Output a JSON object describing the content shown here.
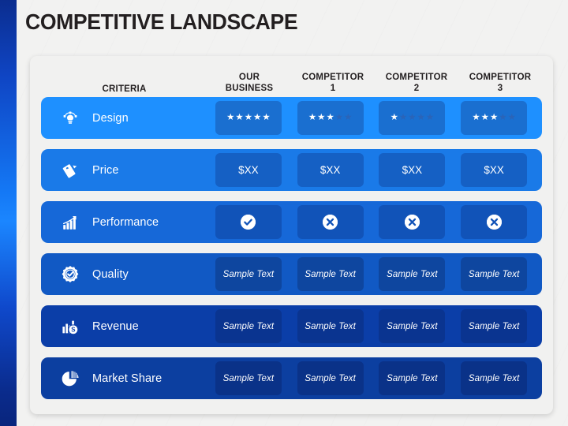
{
  "slide": {
    "title": "COMPETITIVE LANDSCAPE"
  },
  "table": {
    "headers": {
      "criteria": "CRITERIA",
      "columns": [
        "OUR\nBUSINESS",
        "COMPETITOR\n1",
        "COMPETITOR\n2",
        "COMPETITOR\n3"
      ]
    },
    "rows": [
      {
        "label": "Design",
        "icon": "pen-nib-icon",
        "type": "rating",
        "row_color": "#1e90ff",
        "cell_color": "#1a6fd0",
        "values": [
          5,
          3,
          1,
          3
        ],
        "max_rating": 5
      },
      {
        "label": "Price",
        "icon": "price-tag-icon",
        "type": "text",
        "row_color": "#1a7ae8",
        "cell_color": "#1560c4",
        "values": [
          "$XX",
          "$XX",
          "$XX",
          "$XX"
        ]
      },
      {
        "label": "Performance",
        "icon": "growth-chart-icon",
        "type": "mark",
        "row_color": "#1668d8",
        "cell_color": "#1153b8",
        "values": [
          "check",
          "cross",
          "cross",
          "cross"
        ]
      },
      {
        "label": "Quality",
        "icon": "quality-badge-icon",
        "type": "text",
        "row_color": "#1159c4",
        "cell_color": "#0e469f",
        "values": [
          "Sample Text",
          "Sample Text",
          "Sample Text",
          "Sample Text"
        ]
      },
      {
        "label": "Revenue",
        "icon": "revenue-coin-icon",
        "type": "text",
        "row_color": "#0b3ea8",
        "cell_color": "#0a3490",
        "values": [
          "Sample Text",
          "Sample Text",
          "Sample Text",
          "Sample Text"
        ]
      },
      {
        "label": "Market Share",
        "icon": "pie-chart-icon",
        "type": "text",
        "row_color": "#0c3fa0",
        "cell_color": "#0a3288",
        "values": [
          "Sample Text",
          "Sample Text",
          "Sample Text",
          "Sample Text"
        ]
      }
    ]
  },
  "colors": {
    "accent": "#1e90ff",
    "deep": "#0a3288",
    "background": "#f2f2f1",
    "title": "#231f20"
  }
}
